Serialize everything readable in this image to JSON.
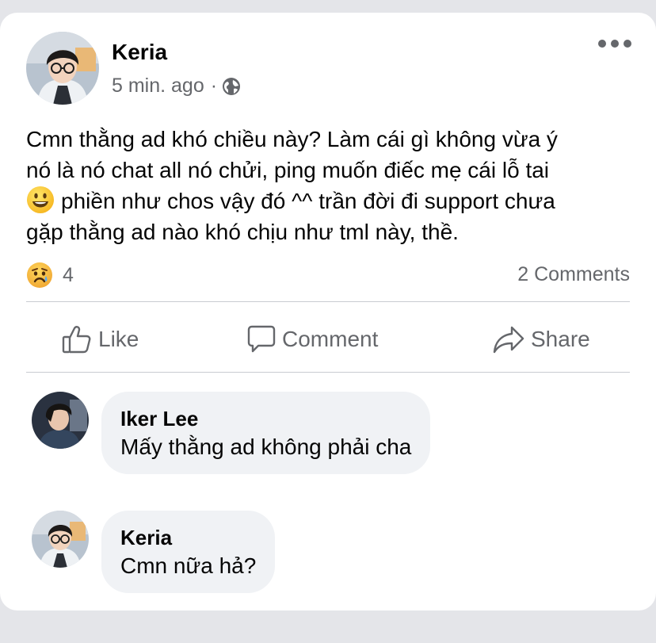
{
  "post": {
    "author": "Keria",
    "time": "5 min. ago",
    "separator": "·",
    "privacy_icon": "globe-icon",
    "more_icon": "more-dots-icon",
    "text_lines": [
      "Cmn thằng ad khó chiều này? Làm cái gì không vừa ý",
      "nó là nó chat all nó chửi, ping muốn điếc mẹ cái lỗ tai",
      "phiền như chos vậy đó ^^ trần đời đi support chưa",
      "gặp thằng ad nào khó chịu như tml này, thề."
    ],
    "inline_emoji": "smiley-emoji",
    "reaction_icon": "sad-reaction-icon",
    "reaction_count": "4",
    "comments_count": "2 Comments"
  },
  "actions": {
    "like": "Like",
    "comment": "Comment",
    "share": "Share"
  },
  "comments": [
    {
      "author": "Iker Lee",
      "text": "Mấy thằng ad không phải cha"
    },
    {
      "author": "Keria",
      "text": "Cmn nữa hả?"
    }
  ],
  "colors": {
    "background": "#e4e5e9",
    "card": "#ffffff",
    "text_primary": "#050505",
    "text_secondary": "#65676b",
    "bubble": "#f0f2f5",
    "divider": "#c9ccd1"
  }
}
